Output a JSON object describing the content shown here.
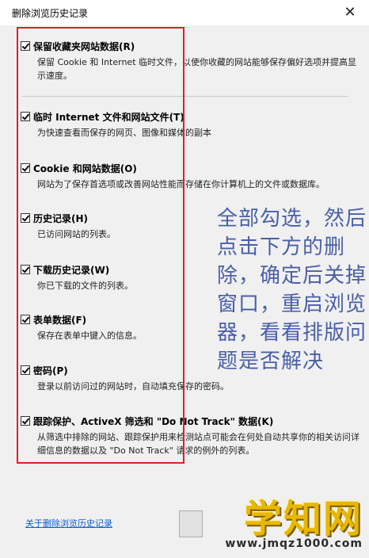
{
  "window": {
    "title": "删除浏览历史记录",
    "close_glyph": "✕"
  },
  "options": [
    {
      "label": "保留收藏夹网站数据(R)",
      "desc": "保留 Cookie 和 Internet 临时文件，以使你收藏的网站能够保存偏好选项并提高显示速度。",
      "checked": true
    },
    {
      "label": "临时 Internet 文件和网站文件(T)",
      "desc": "为快速查看而保存的网页、图像和媒体的副本",
      "checked": true
    },
    {
      "label": "Cookie 和网站数据(O)",
      "desc": "网站为了保存首选项或改善网站性能而存储在你计算机上的文件或数据库。",
      "checked": true
    },
    {
      "label": "历史记录(H)",
      "desc": "已访问网站的列表。",
      "checked": true
    },
    {
      "label": "下载历史记录(W)",
      "desc": "你已下载的文件的列表。",
      "checked": true
    },
    {
      "label": "表单数据(F)",
      "desc": "保存在表单中键入的信息。",
      "checked": true
    },
    {
      "label": "密码(P)",
      "desc": "登录以前访问过的网站时，自动填充保存的密码。",
      "checked": true
    },
    {
      "label": "跟踪保护、ActiveX 筛选和 \"Do Not Track\" 数据(K)",
      "desc": "从筛选中排除的网站、跟踪保护用来检测站点可能会在何处自动共享你的相关访问详细信息的数据以及 \"Do Not Track\" 请求的例外的列表。",
      "checked": true
    }
  ],
  "annotation": "全部勾选，然后点击下方的删除，确定后关掉窗口，重启浏览器，看看排版问题是否解决",
  "footer": {
    "help_link": "关于删除浏览历史记录"
  },
  "watermark": {
    "main": "学知网",
    "url": "www.jmqz1000.com"
  },
  "colors": {
    "highlight_box": "#e02020",
    "annotation_text": "#4a5fa8",
    "link": "#0a5fd0",
    "watermark": "#e8b800"
  }
}
